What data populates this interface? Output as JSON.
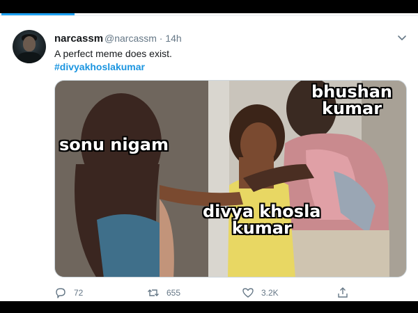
{
  "tweet": {
    "display_name": "narcassm",
    "handle_time": "@narcassm · 14h",
    "text": "A perfect meme does exist.",
    "hashtag": "#divyakhoslakumar"
  },
  "media": {
    "captions": {
      "left": "sonu nigam",
      "top_right_line1": "bhushan",
      "top_right_line2": "kumar",
      "center_line1": "divya khosla",
      "center_line2": "kumar"
    }
  },
  "actions": {
    "replies": "72",
    "retweets": "655",
    "likes": "3.2K"
  },
  "colors": {
    "accent": "#1da1f2",
    "hashtag": "#1b95e0",
    "muted": "#657786"
  }
}
